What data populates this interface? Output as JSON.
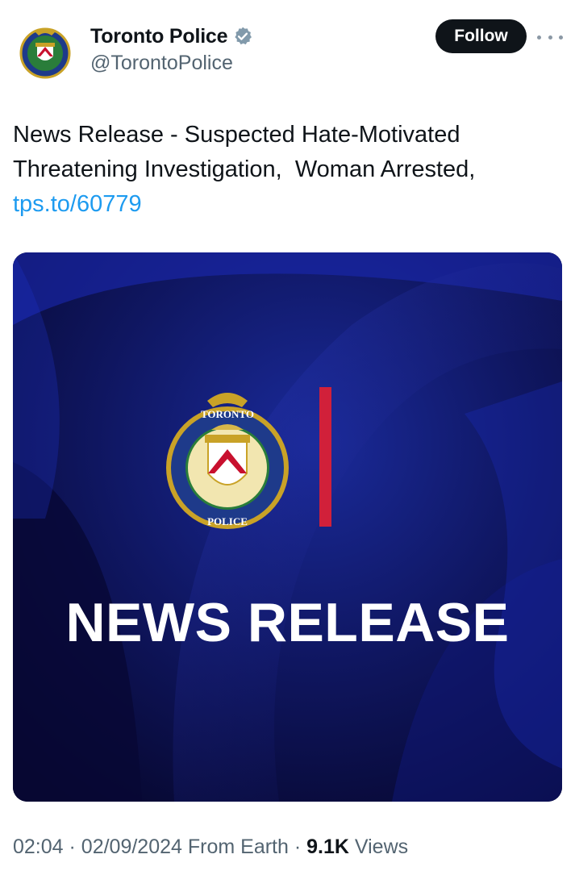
{
  "author": {
    "display_name": "Toronto Police",
    "handle": "@TorontoPolice",
    "verified": true
  },
  "actions": {
    "follow_label": "Follow",
    "more_icon": "more-horizontal-icon"
  },
  "tweet": {
    "text": "News Release - Suspected Hate-Motivated\nThreatening Investigation,  Woman Arrested,\n",
    "link": "tps.to/60779"
  },
  "media": {
    "badge_top": "TORONTO",
    "badge_bottom": "POLICE",
    "title": "NEWS RELEASE",
    "accent_color": "#d1203a",
    "background_color": "#0a0a2e"
  },
  "meta": {
    "time": "02:04",
    "date": "02/09/2024",
    "source": "From Earth",
    "views_count": "9.1K",
    "views_label": "Views",
    "separator": "·"
  },
  "colors": {
    "link": "#1d9bf0",
    "verified": "#829aab",
    "secondary_text": "#536471",
    "primary_text": "#0f1419"
  }
}
